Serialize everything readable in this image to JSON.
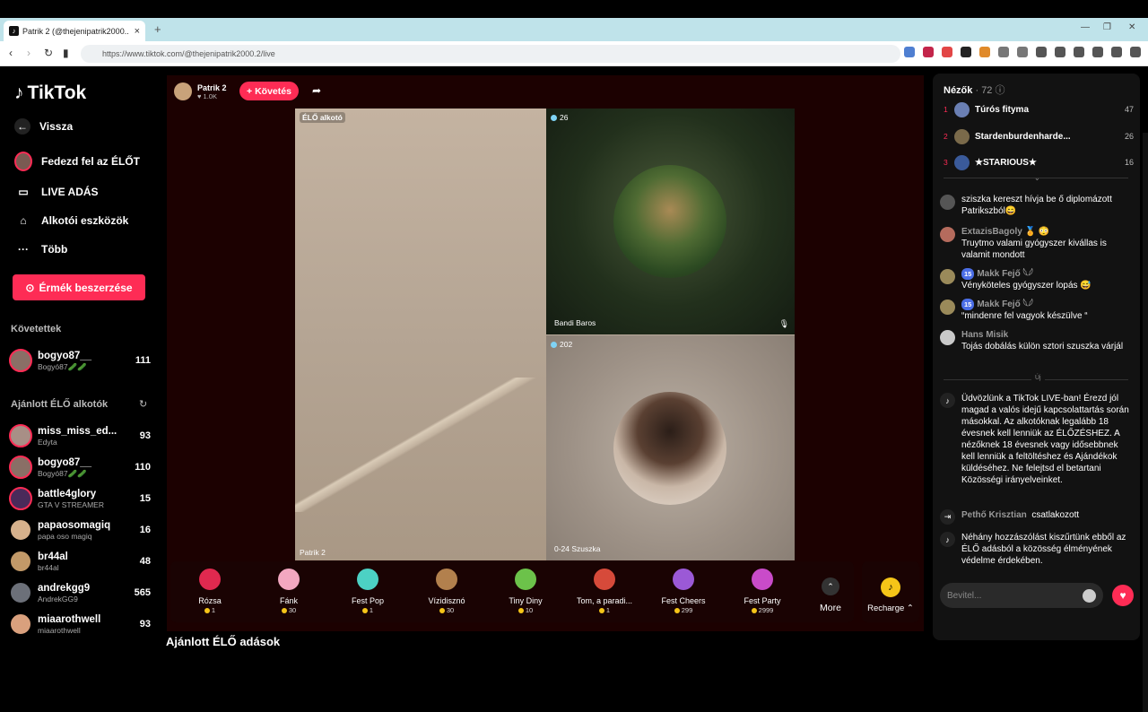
{
  "browser": {
    "tab_title": "Patrik 2 (@thejenipatrik2000...",
    "url": "https://www.tiktok.com/@thejenipatrik2000.2/live"
  },
  "sidebar": {
    "logo": "TikTok",
    "nav": [
      {
        "label": "Vissza",
        "icon": "back-arrow-icon"
      },
      {
        "label": "Fedezd fel az ÉLŐT",
        "icon": "avatar-icon"
      },
      {
        "label": "LIVE ADÁS",
        "icon": "video-camera-icon"
      },
      {
        "label": "Alkotói eszközök",
        "icon": "home-icon"
      },
      {
        "label": "Több",
        "icon": "more-dots-icon"
      }
    ],
    "coin_button": "Érmék beszerzése",
    "following_heading": "Követettek",
    "following": [
      {
        "name": "bogyo87__",
        "sub": "Bogyó87🥒🥒",
        "count": "111",
        "color": "#8a6f66"
      }
    ],
    "recommended_heading": "Ajánlott ÉLŐ alkotók",
    "recommended": [
      {
        "name": "miss_miss_ed...",
        "sub": "Edyta",
        "count": "93",
        "color": "#a88f86"
      },
      {
        "name": "bogyo87__",
        "sub": "Bogyó87🥒🥒",
        "count": "110",
        "color": "#8a6f66"
      },
      {
        "name": "battle4glory",
        "sub": "GTA V STREAMER",
        "count": "15",
        "color": "#4a2a5a"
      },
      {
        "name": "papaosomagiq",
        "sub": "papa oso magiq",
        "count": "16",
        "color": "#d6b18c"
      },
      {
        "name": "br44al",
        "sub": "br44al",
        "count": "48",
        "color": "#c29968"
      },
      {
        "name": "andrekgg9",
        "sub": "AndrekGG9",
        "count": "565",
        "color": "#6c7079"
      },
      {
        "name": "miaarothwell",
        "sub": "miaarothwell",
        "count": "93",
        "color": "#d9a07d"
      }
    ]
  },
  "host": {
    "name": "Patrik 2",
    "likes": "♥ 1.0K",
    "follow": "+ Követés"
  },
  "video": {
    "live_tag": "ÉLŐ alkotó",
    "host_cam_name": "Patrik 2",
    "guest1": {
      "viewers": "26",
      "name": "Bandi Baros"
    },
    "guest2": {
      "viewers": "202",
      "name": "0-24 Szuszka"
    }
  },
  "gifts": [
    {
      "name": "Rózsa",
      "price": "1",
      "color": "#e0294f"
    },
    {
      "name": "Fánk",
      "price": "30",
      "color": "#f2a7c0"
    },
    {
      "name": "Fest Pop",
      "price": "1",
      "color": "#4cd1c4"
    },
    {
      "name": "Vízidisznó",
      "price": "30",
      "color": "#b2804d"
    },
    {
      "name": "Tiny Diny",
      "price": "10",
      "color": "#6cc24a"
    },
    {
      "name": "Tom, a paradi...",
      "price": "1",
      "color": "#d64a3a"
    },
    {
      "name": "Fest Cheers",
      "price": "299",
      "color": "#9b59d6"
    },
    {
      "name": "Fest Party",
      "price": "2999",
      "color": "#c94bc9"
    }
  ],
  "gift_more": "More",
  "recharge": "Recharge ⌃",
  "recommended_live_title": "Ajánlott ÉLŐ adások",
  "chat": {
    "viewers_label": "Nézők",
    "viewers_count": "· 72",
    "top_viewers": [
      {
        "rank": "1",
        "name": "Túrós fityma",
        "count": "47",
        "color": "#6a7fb3"
      },
      {
        "rank": "2",
        "name": "Stardenburdenharde...",
        "count": "26",
        "color": "#7a6a4a"
      },
      {
        "rank": "3",
        "name": "★STARIOUS★",
        "count": "16",
        "color": "#3a5a9a"
      }
    ],
    "messages": [
      {
        "name": "",
        "text": "sziszka kereszt hívja be ő diplomázott Patrikszból😄",
        "color": "#555",
        "level": ""
      },
      {
        "name": "ExtazisBagoly 🏅 😳",
        "text": "Truytmo valami gyógyszer kivállas is valamit mondott",
        "color": "#b56b5d",
        "level": ""
      },
      {
        "name": "Makk Fejő 𓆩𓆪",
        "text": "Vényköteles gyógyszer lopás 😅",
        "color": "#9a8a5a",
        "level": "15"
      },
      {
        "name": "Makk Fejő 𓆩𓆪",
        "text": "“mindenre fel vagyok készülve “",
        "color": "#9a8a5a",
        "level": "15"
      },
      {
        "name": "Hans Misik",
        "text": "Tojás dobálás külön sztori szuszka várjál",
        "color": "#c9c9c9",
        "level": ""
      }
    ],
    "new_label": "Új",
    "system_welcome": "Üdvözlünk a TikTok LIVE-ban! Érezd jól magad a valós idejű kapcsolattartás során másokkal. Az alkotóknak legalább 18 évesnek kell lenniük az ÉLŐZÉSHEZ. A nézőknek 18 évesnek vagy idősebbnek kell lenniük a feltöltéshez és Ajándékok küldéséhez. Ne felejtsd el betartani Közösségi irányelveinket.",
    "join_name": "Pethő Krisztian",
    "join_text": "csatlakozott",
    "system_filter": "Néhány hozzászólást kiszűrtünk ebből az ÉLŐ adásból a közösség élményének védelme érdekében.",
    "input_placeholder": "Bevitel..."
  }
}
